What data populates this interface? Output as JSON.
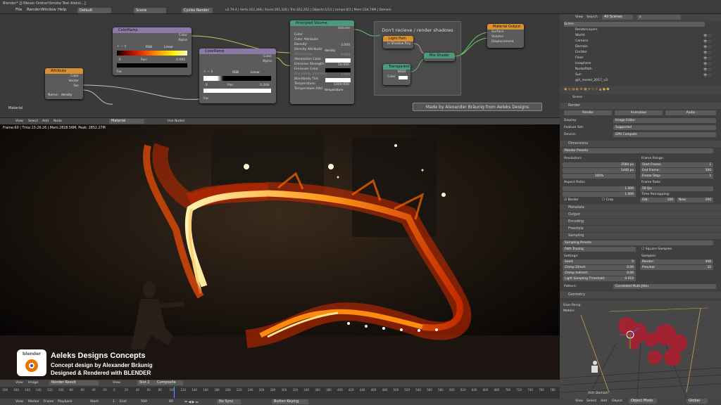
{
  "topbar": {
    "title": "Blender* [J:\\Neuer Ordner\\Smoke Test Aleks\\...]",
    "menus": [
      "File",
      "Render",
      "Window",
      "Help"
    ],
    "layout": "Default",
    "scene": "Scene",
    "engine": "Cycles Render",
    "stats": "v2.79.4 | Verts:162,348 | Faces:161,326 | Tris:322,252 | Objects:1/13 | Lamps:0/1 | Mem:334.74M | Domain"
  },
  "nodes": {
    "colorramp1": {
      "title": "ColorRamp",
      "out1": "Color",
      "out2": "Alpha",
      "mode": "RGB",
      "interp": "Linear",
      "index": "0",
      "pos": "Pos:",
      "posval": "0.085",
      "fac": "Fac"
    },
    "colorramp2": {
      "title": "ColorRamp",
      "out1": "Color",
      "out2": "Alpha",
      "mode": "RGB",
      "interp": "Linear",
      "index": "0",
      "pos": "Pos:",
      "posval": "0.208",
      "fac": "Fac"
    },
    "attribute": {
      "title": "Attribute",
      "out1": "Color",
      "out2": "Vector",
      "out3": "Fac",
      "name_label": "Name:",
      "name_val": "density"
    },
    "volume": {
      "title": "Principled Volume",
      "out": "Volume",
      "rows": [
        "Color",
        "Color Attribute",
        "Density:",
        "Density Attribute:",
        "Anisotropy:",
        "Absorption Color",
        "Emission Strength:",
        "Emission Color",
        "Blackbody Intensity:",
        "Blackbody Tint",
        "Temperature:",
        "Temperature Attri..."
      ],
      "density": "3.000",
      "dens_attr": "density",
      "aniso": "0.000",
      "emit": "10.000",
      "bb": "1.000",
      "temp": "1000.000",
      "temp_attr": "temperature"
    },
    "frame_label": "Don't recieve / render shadows",
    "lightpath": {
      "title": "Light Path",
      "row": "Is Shadow Ray"
    },
    "transparent": {
      "title": "Transparent ...",
      "row1": "BSDF",
      "row2": "Color"
    },
    "mixshader": {
      "title": "Mix Shader"
    },
    "output": {
      "title": "Material Output",
      "rows": [
        "Surface",
        "Volume",
        "Displacement"
      ]
    },
    "material_label": "Material",
    "credit": "Made by Alexander Bräunig from Aeleks Designs"
  },
  "nodebar": {
    "items": [
      "View",
      "Select",
      "Add",
      "Node"
    ],
    "material": "Material",
    "use_nodes": "Use Nodes"
  },
  "render": {
    "info": "Frame:60 | Time:15:26.26 | Mem:2828.56M, Peak: 2852.27M",
    "logo_text": "blender",
    "line1": "Aeleks Designs Concepts",
    "line2": "Concept design by Alexander Bräunig",
    "line3": "Designed & Rendered with BLENDER"
  },
  "imagebar": {
    "items": [
      "View",
      "Image"
    ],
    "result": "Render Result",
    "slot": "Slot 2",
    "pass": "Composite",
    "view": "View"
  },
  "timeline": {
    "ticks": [
      "-200",
      "-180",
      "-160",
      "-140",
      "-120",
      "-100",
      "-80",
      "-60",
      "-40",
      "-20",
      "0",
      "20",
      "40",
      "60",
      "80",
      "100",
      "120",
      "140",
      "160",
      "180",
      "200",
      "220",
      "240",
      "260",
      "280",
      "300",
      "320",
      "340",
      "360",
      "380",
      "400",
      "420",
      "440",
      "460",
      "480",
      "500",
      "520",
      "540",
      "560",
      "580",
      "600",
      "620",
      "640",
      "660",
      "680",
      "700",
      "720",
      "740",
      "760",
      "780"
    ],
    "menus": [
      "View",
      "Marker",
      "Frame",
      "Playback"
    ],
    "start_label": "Start:",
    "start_val": "1",
    "end_label": "End:",
    "end_val": "500",
    "current": "60",
    "sync": "No Sync",
    "keying": "Button Keying"
  },
  "outliner": {
    "menus": [
      "View",
      "Search",
      "All Scenes"
    ],
    "items": [
      "Scene",
      "RenderLayers",
      "World",
      "Camera",
      "Domain",
      "Emitter",
      "Floor",
      "Icosphere",
      "NurbsPath",
      "Sun",
      "girl_model_2017_v3"
    ]
  },
  "properties": {
    "scene": "Scene",
    "render_section": "Render",
    "buttons": [
      "Render",
      "Animation",
      "Audio"
    ],
    "display_label": "Display:",
    "display_val": "Image Editor",
    "feature_label": "Feature Set:",
    "feature_val": "Supported",
    "device_label": "Device:",
    "device_val": "GPU Compute",
    "dimensions": "Dimensions",
    "render_presets": "Render Presets",
    "resolution": "Resolution:",
    "res_x": "2560 px",
    "res_y": "1440 px",
    "res_pct": "100%",
    "frame_range": "Frame Range:",
    "start_frame": "Start Frame:",
    "start_frame_val": "1",
    "end_frame": "End Frame:",
    "end_frame_val": "500",
    "frame_step": "Frame Step:",
    "frame_step_val": "1",
    "aspect": "Aspect Ratio:",
    "asp_x": "1.000",
    "asp_y": "1.000",
    "frame_rate": "Frame Rate:",
    "fps": "50 fps",
    "time_remap": "Time Remapping:",
    "old": "Old:",
    "old_val": "100",
    "new": "New:",
    "new_val": "100",
    "border": "Border",
    "crop": "Crop",
    "sections": [
      "Metadata",
      "Output",
      "Encoding",
      "Freestyle",
      "Sampling"
    ],
    "sampling_presets": "Sampling Presets",
    "path_tracing": "Path Tracing",
    "square": "Square Samples",
    "settings": "Settings:",
    "samples": "Samples:",
    "seed": "Seed:",
    "seed_val": "0",
    "clamp_direct": "Clamp Direct:",
    "clamp_direct_val": "0.00",
    "clamp_indirect": "Clamp Indirect:",
    "clamp_indirect_val": "0.00",
    "light_thresh": "Light Sampling Threshold:",
    "light_thresh_val": "0.010",
    "render_samples": "Render:",
    "render_samples_val": "448",
    "preview": "Preview:",
    "preview_val": "32",
    "pattern": "Pattern:",
    "pattern_val": "Correlated Multi-Jitter",
    "geometry": "Geometry"
  },
  "viewport": {
    "label1": "User Persp",
    "label2": "Meters",
    "footer": "(60) Domain",
    "menus": [
      "View",
      "Select",
      "Add",
      "Object"
    ],
    "mode": "Object Mode",
    "global": "Global"
  },
  "colors": {
    "fire_core": "#fff3b0",
    "fire_mid": "#ff9a1a",
    "fire_edge": "#c42a00",
    "node_green": "#4a9a2e",
    "node_orange": "#e0962a",
    "node_purple": "#6e5a8a"
  }
}
